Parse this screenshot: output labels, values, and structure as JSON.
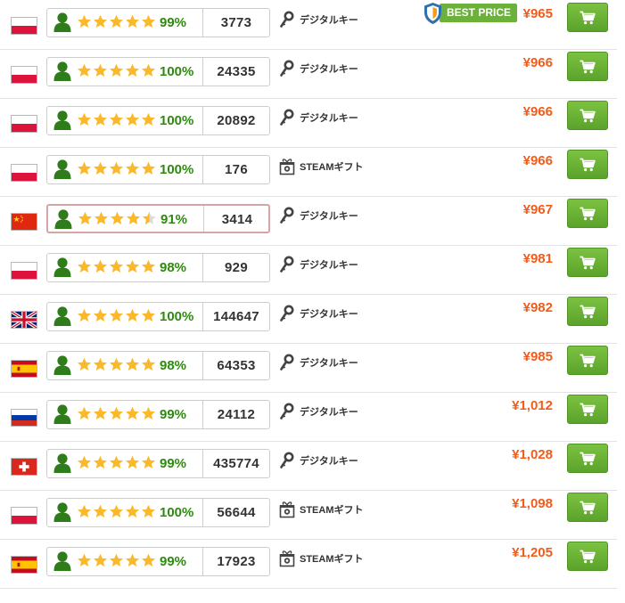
{
  "icons": {
    "seller_avatar": "user-icon",
    "cart": "shopping-cart-icon",
    "digital_key": "key-icon",
    "steam_gift": "gift-icon",
    "best_price": "shield-icon"
  },
  "colors": {
    "rating_green": "#2e8a0f",
    "price_orange": "#f25c1b",
    "cart_green": "#6cb23a",
    "star": "#fbb829"
  },
  "offers": [
    {
      "flag": "poland",
      "stars": 5,
      "rating": "99%",
      "reviews": "3773",
      "product_type": "デジタルキー",
      "type_icon": "key",
      "best_price": "BEST PRICE",
      "price": "¥965"
    },
    {
      "flag": "poland",
      "stars": 5,
      "rating": "100%",
      "reviews": "24335",
      "product_type": "デジタルキー",
      "type_icon": "key",
      "price": "¥966"
    },
    {
      "flag": "poland",
      "stars": 5,
      "rating": "100%",
      "reviews": "20892",
      "product_type": "デジタルキー",
      "type_icon": "key",
      "price": "¥966"
    },
    {
      "flag": "poland",
      "stars": 5,
      "rating": "100%",
      "reviews": "176",
      "product_type": "STEAMギフト",
      "type_icon": "gift",
      "price": "¥966"
    },
    {
      "flag": "china",
      "stars": 4.5,
      "rating": "91%",
      "reviews": "3414",
      "product_type": "デジタルキー",
      "type_icon": "key",
      "price": "¥967",
      "highlighted": true
    },
    {
      "flag": "poland",
      "stars": 5,
      "rating": "98%",
      "reviews": "929",
      "product_type": "デジタルキー",
      "type_icon": "key",
      "price": "¥981"
    },
    {
      "flag": "united-kingdom",
      "stars": 5,
      "rating": "100%",
      "reviews": "144647",
      "product_type": "デジタルキー",
      "type_icon": "key",
      "price": "¥982"
    },
    {
      "flag": "spain",
      "stars": 5,
      "rating": "98%",
      "reviews": "64353",
      "product_type": "デジタルキー",
      "type_icon": "key",
      "price": "¥985"
    },
    {
      "flag": "russia",
      "stars": 5,
      "rating": "99%",
      "reviews": "24112",
      "product_type": "デジタルキー",
      "type_icon": "key",
      "price": "¥1,012"
    },
    {
      "flag": "switzerland",
      "stars": 5,
      "rating": "99%",
      "reviews": "435774",
      "product_type": "デジタルキー",
      "type_icon": "key",
      "price": "¥1,028"
    },
    {
      "flag": "poland",
      "stars": 5,
      "rating": "100%",
      "reviews": "56644",
      "product_type": "STEAMギフト",
      "type_icon": "gift",
      "price": "¥1,098"
    },
    {
      "flag": "spain",
      "stars": 5,
      "rating": "99%",
      "reviews": "17923",
      "product_type": "STEAMギフト",
      "type_icon": "gift",
      "price": "¥1,205"
    }
  ]
}
